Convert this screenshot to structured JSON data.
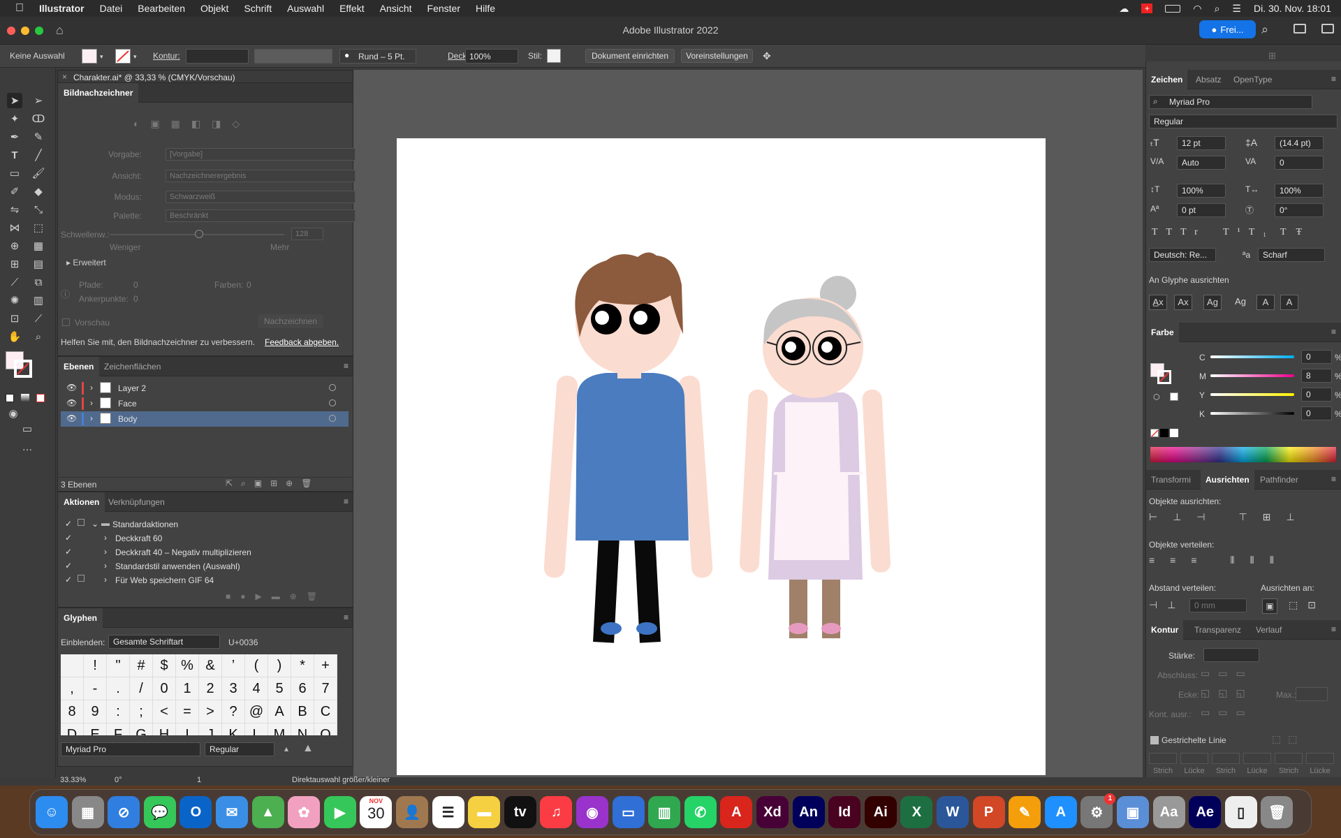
{
  "menubar": {
    "apple_icon": "apple-icon",
    "items": [
      "Illustrator",
      "Datei",
      "Bearbeiten",
      "Objekt",
      "Schrift",
      "Auswahl",
      "Effekt",
      "Ansicht",
      "Fenster",
      "Hilfe"
    ],
    "clock": "Di. 30. Nov.  18:01"
  },
  "window": {
    "title": "Adobe Illustrator 2022",
    "share_label": "Frei..."
  },
  "control_bar": {
    "selection": "Keine Auswahl",
    "stroke_label": "Kontur:",
    "brush_label": "Rund – 5 Pt.",
    "opacity_label": "Deckkraft:",
    "opacity_value": "100%",
    "style_label": "Stil:",
    "setup_doc_button": "Dokument einrichten",
    "prefs_button": "Voreinstellungen"
  },
  "document": {
    "tab_title": "Charakter.ai* @ 33,33 % (CMYK/Vorschau)"
  },
  "image_trace": {
    "title": "Bildnachzeichner",
    "preset_label": "Vorgabe:",
    "preset_value": "[Vorgabe]",
    "view_label": "Ansicht:",
    "view_value": "Nachzeichnerergebnis",
    "mode_label": "Modus:",
    "mode_value": "Schwarzweiß",
    "palette_label": "Palette:",
    "palette_value": "Beschränkt",
    "threshold_label": "Schwellenw.:",
    "threshold_value": "128",
    "less": "Weniger",
    "more": "Mehr",
    "advanced": "Erweitert",
    "paths_label": "Pfade:",
    "paths_value": "0",
    "colors_label": "Farben:",
    "colors_value": "0",
    "anchors_label": "Ankerpunkte:",
    "anchors_value": "0",
    "preview_label": "Vorschau",
    "trace_button": "Nachzeichnen",
    "feedback_text": "Helfen Sie mit, den Bildnachzeichner zu verbessern.",
    "feedback_link": "Feedback abgeben."
  },
  "layers_panel": {
    "tabs": [
      "Ebenen",
      "Zeichenflächen"
    ],
    "layers": [
      {
        "name": "Layer 2",
        "color": "#e04545"
      },
      {
        "name": "Face",
        "color": "#e04545"
      },
      {
        "name": "Body",
        "color": "#4a7fd6"
      }
    ],
    "count": "3 Ebenen"
  },
  "actions_panel": {
    "tabs": [
      "Aktionen",
      "Verknüpfungen"
    ],
    "items": [
      "Standardaktionen",
      "Deckkraft 60",
      "Deckkraft 40 – Negativ multiplizieren",
      "Standardstil anwenden (Auswahl)",
      "Für Web speichern GIF 64"
    ]
  },
  "glyphs_panel": {
    "title": "Glyphen",
    "show_label": "Einblenden:",
    "show_value": "Gesamte Schriftart",
    "unicode": "U+0036",
    "glyphs": [
      " ",
      "!",
      "\"",
      "#",
      "$",
      "%",
      "&",
      "’",
      "(",
      ")",
      "*",
      "+",
      ",",
      "-",
      ".",
      "/",
      "0",
      "1",
      "2",
      "3",
      "4",
      "5",
      "6",
      "7",
      "8",
      "9",
      ":",
      ";",
      "<",
      "=",
      ">",
      "?",
      "@",
      "A",
      "B",
      "C",
      "D",
      "E",
      "F",
      "G",
      "H",
      "I",
      "J",
      "K",
      "L",
      "M",
      "N",
      "O"
    ],
    "font": "Myriad Pro",
    "style": "Regular"
  },
  "character_panel": {
    "tabs": [
      "Zeichen",
      "Absatz",
      "OpenType"
    ],
    "font": "Myriad Pro",
    "style": "Regular",
    "size": "12 pt",
    "leading": "(14.4 pt)",
    "kerning": "Auto",
    "tracking": "0",
    "vscale": "100%",
    "hscale": "100%",
    "baseline": "0 pt",
    "rotation": "0°",
    "language": "Deutsch: Re...",
    "antialias": "Scharf",
    "snap_label": "An Glyphe ausrichten"
  },
  "color_panel": {
    "title": "Farbe",
    "channels": [
      {
        "label": "C",
        "value": "0"
      },
      {
        "label": "M",
        "value": "8"
      },
      {
        "label": "Y",
        "value": "0"
      },
      {
        "label": "K",
        "value": "0"
      }
    ],
    "percent": "%"
  },
  "align_panel": {
    "tabs": [
      "Transformi",
      "Ausrichten",
      "Pathfinder"
    ],
    "align_objects": "Objekte ausrichten:",
    "distribute_objects": "Objekte verteilen:",
    "distribute_spacing": "Abstand verteilen:",
    "align_to": "Ausrichten an:",
    "spacing_value": "0 mm"
  },
  "stroke_panel": {
    "tabs": [
      "Kontur",
      "Transparenz",
      "Verlauf"
    ],
    "weight_label": "Stärke:",
    "cap_label": "Abschluss:",
    "corner_label": "Ecke:",
    "limit_label": "Max.:",
    "align_label": "Kont. ausr.:",
    "dashed_label": "Gestrichelte Linie",
    "dash_labels": [
      "Strich",
      "Lücke",
      "Strich",
      "Lücke",
      "Strich",
      "Lücke"
    ]
  },
  "status_bar": {
    "zoom": "33.33%",
    "rotation": "0°",
    "artboard": "1",
    "tool_hint": "Direktauswahl größer/kleiner"
  },
  "dock": {
    "apps": [
      "Finder",
      "Launchpad",
      "Safari",
      "Nachrichten",
      "Outlook",
      "Mail",
      "Karten",
      "Fotos",
      "FaceTime",
      "Kalender",
      "Kontakte",
      "Erinnerungen",
      "Notizen",
      "TV",
      "Musik",
      "Podcasts",
      "Keynote",
      "Numbers",
      "WhatsApp",
      "Acrobat",
      "Xd",
      "An",
      "Id",
      "Ai",
      "Excel",
      "Word",
      "PowerPoint",
      "Pages",
      "App Store",
      "Systemeinstellungen",
      "Vorschau",
      "Schriftsammlung",
      "Ae",
      "Dokument",
      "Papierkorb"
    ],
    "calendar_month": "NOV",
    "calendar_day": "30",
    "badge": "1"
  },
  "colors": {
    "boy_shirt": "#4a7cbf",
    "boy_hair": "#8c5a3c",
    "skin": "#fbdcd0",
    "grandma_dress": "#dccbe3",
    "apron": "#fdf2f7",
    "grey_hair": "#c5c5c5",
    "pants": "#0a0a0a",
    "grandma_legs": "#a08068",
    "shoe_blue": "#3e73c4",
    "shoe_pink": "#e79ac0"
  }
}
